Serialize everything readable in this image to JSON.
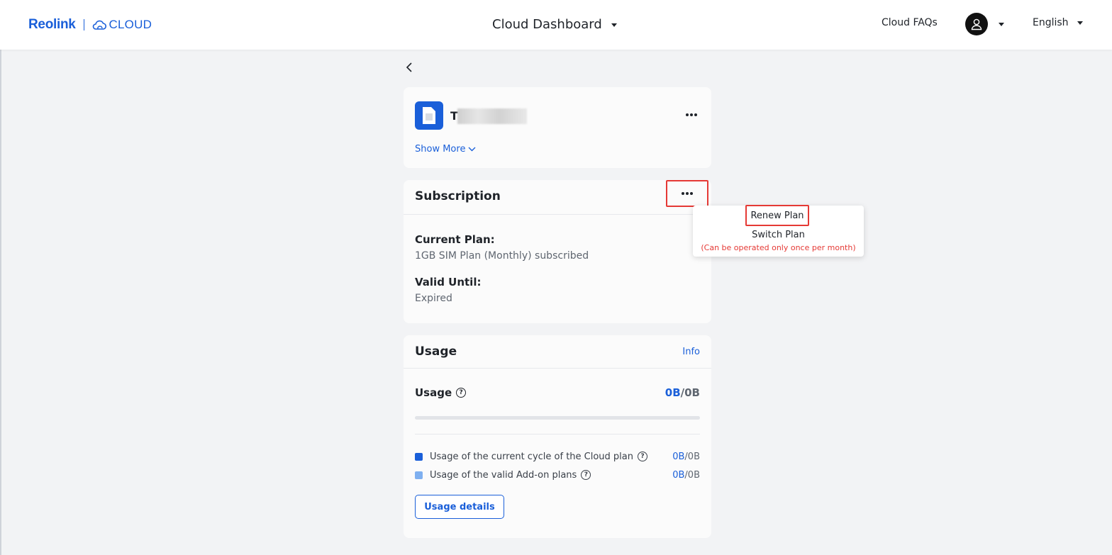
{
  "header": {
    "brand": "Reolink",
    "product": "CLOUD",
    "title": "Cloud Dashboard",
    "faq_link": "Cloud FAQs",
    "language": "English"
  },
  "device": {
    "name": "T",
    "show_more": "Show More"
  },
  "subscription": {
    "title": "Subscription",
    "current_plan_label": "Current Plan:",
    "current_plan_value": "1GB SIM Plan (Monthly) subscribed",
    "valid_until_label": "Valid Until:",
    "valid_until_value": "Expired"
  },
  "menu": {
    "renew": "Renew Plan",
    "switch": "Switch Plan",
    "switch_note": "(Can be operated only once per month)"
  },
  "usage": {
    "title": "Usage",
    "info_link": "Info",
    "usage_label": "Usage",
    "used": "0B",
    "separator": "/",
    "total": "0B",
    "progress_fraction": 0,
    "legend": [
      {
        "label": "Usage of the current cycle of the Cloud plan",
        "used": "0B",
        "total": "0B",
        "color": "#1a5fd9"
      },
      {
        "label": "Usage of the valid Add-on plans",
        "used": "0B",
        "total": "0B",
        "color": "#7fb0f0"
      }
    ],
    "details_button": "Usage details"
  },
  "colors": {
    "accent": "#1a5fd9",
    "highlight": "#e53935",
    "background": "#f2f3f5"
  }
}
